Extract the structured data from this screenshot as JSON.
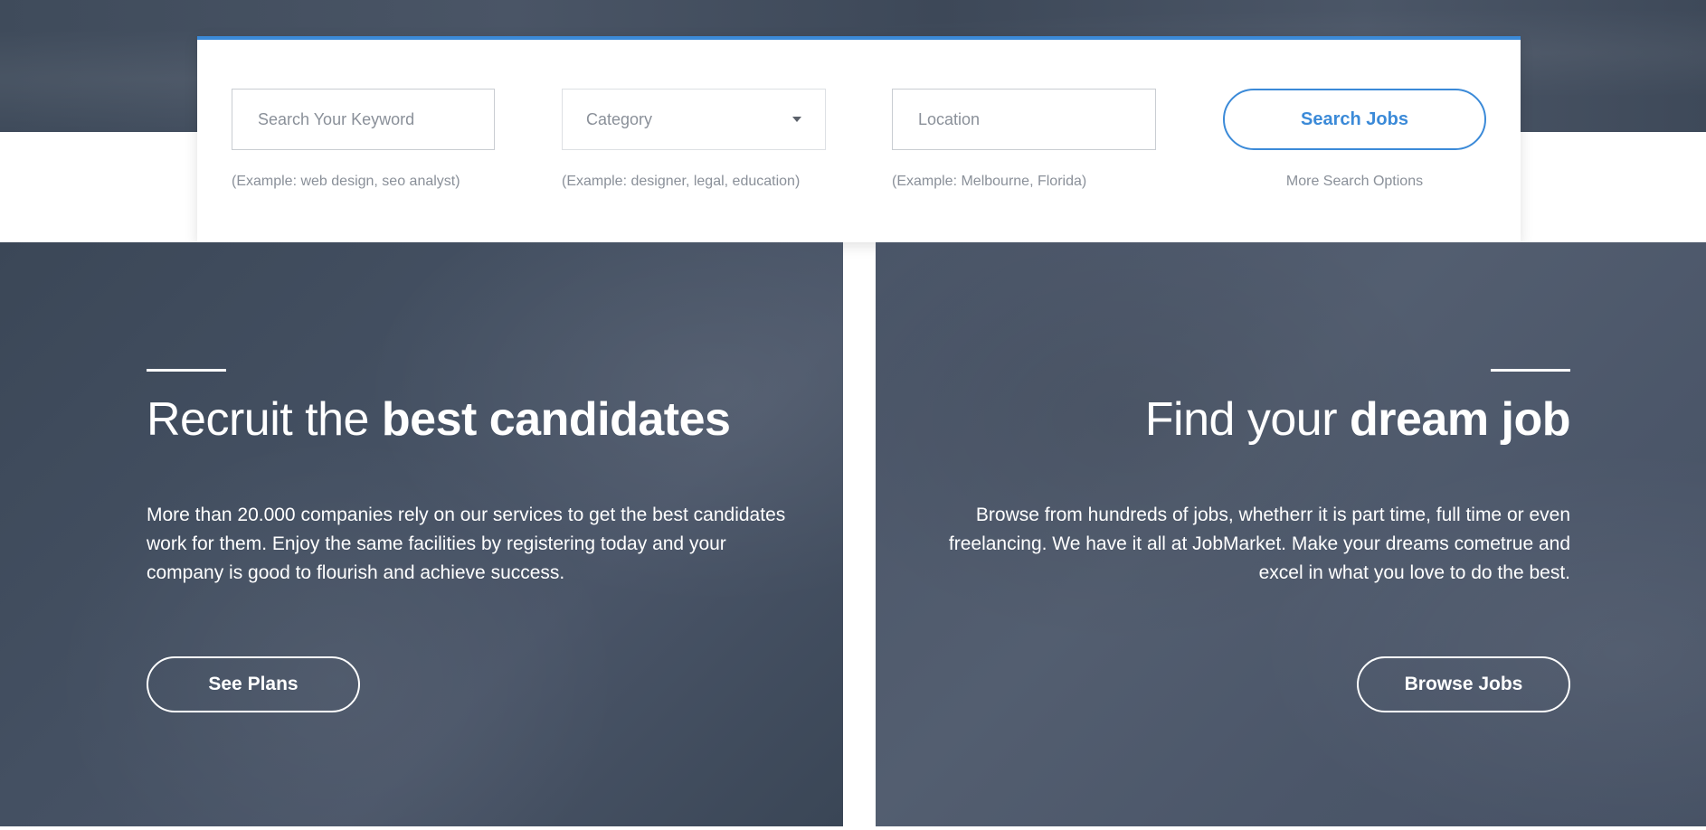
{
  "search": {
    "keyword_placeholder": "Search Your Keyword",
    "category_label": "Category",
    "location_placeholder": "Location",
    "button_label": "Search Jobs",
    "keyword_hint": "(Example: web design, seo analyst)",
    "category_hint": "(Example: designer, legal, education)",
    "location_hint": "(Example: Melbourne, Florida)",
    "more_options": "More Search Options",
    "accent_color": "#3b8ad8"
  },
  "recruit": {
    "heading_light": "Recruit the ",
    "heading_bold": "best candidates",
    "body": "More than 20.000 companies rely on our services to get the best candidates work for them. Enjoy the same facilities by registering today and your company is good to flourish and achieve success.",
    "button_label": "See Plans"
  },
  "find": {
    "heading_light": "Find your ",
    "heading_bold": "dream job",
    "body": "Browse from hundreds of jobs, whetherr it is part time, full time or even freelancing. We have it all at JobMarket. Make your dreams cometrue and excel in what you love to do the best.",
    "button_label": "Browse Jobs"
  }
}
